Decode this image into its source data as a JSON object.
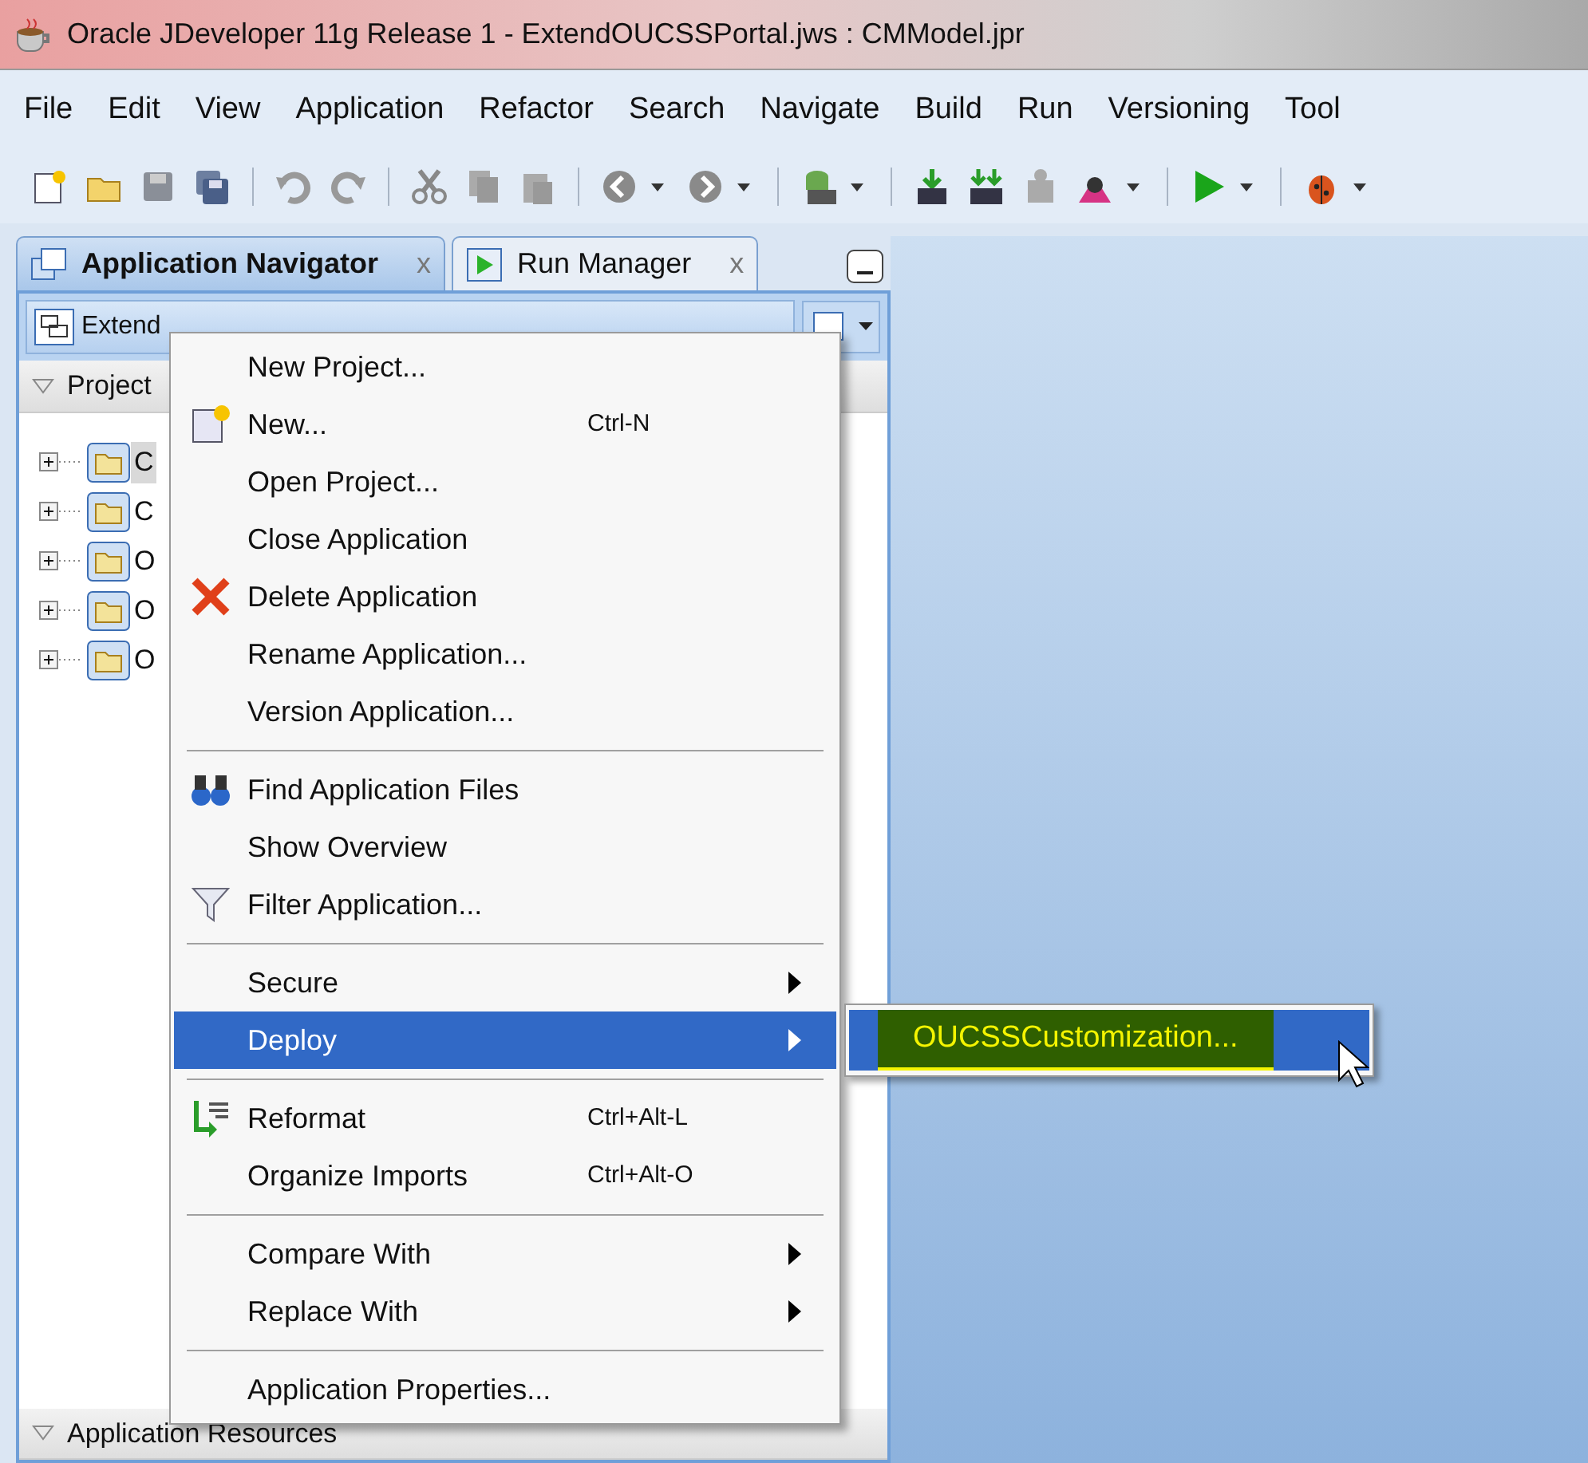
{
  "window": {
    "title": "Oracle JDeveloper 11g Release 1 - ExtendOUCSSPortal.jws : CMModel.jpr"
  },
  "menu_bar": [
    "File",
    "Edit",
    "View",
    "Application",
    "Refactor",
    "Search",
    "Navigate",
    "Build",
    "Run",
    "Versioning",
    "Tool"
  ],
  "navigator": {
    "tabs": [
      {
        "label": "Application Navigator",
        "close": "x",
        "selected": true
      },
      {
        "label": "Run Manager",
        "close": "x",
        "selected": false
      }
    ],
    "application": "Extend",
    "projects_section": {
      "label": "Project",
      "expanded": true
    },
    "tree": [
      {
        "label": "C",
        "selected": true
      },
      {
        "label": "C",
        "selected": false
      },
      {
        "label": "O",
        "selected": false
      },
      {
        "label": "O",
        "selected": false
      },
      {
        "label": "O",
        "selected": false
      }
    ],
    "resources_section": {
      "label": "Application Resources",
      "expanded": true
    }
  },
  "context_menu": {
    "items": [
      {
        "kind": "item",
        "label": "New Project...",
        "selected": false
      },
      {
        "kind": "item",
        "label": "New...",
        "shortcut": "Ctrl-N",
        "selected": false
      },
      {
        "kind": "item",
        "label": "Open Project...",
        "selected": false
      },
      {
        "kind": "item",
        "label": "Close Application",
        "selected": false
      },
      {
        "kind": "item",
        "label": "Delete Application",
        "selected": false
      },
      {
        "kind": "item",
        "label": "Rename Application...",
        "selected": false
      },
      {
        "kind": "item",
        "label": "Version Application...",
        "selected": false
      },
      {
        "kind": "separator"
      },
      {
        "kind": "item",
        "label": "Find Application Files",
        "selected": false
      },
      {
        "kind": "item",
        "label": "Show Overview",
        "selected": false
      },
      {
        "kind": "item",
        "label": "Filter Application...",
        "selected": false
      },
      {
        "kind": "separator"
      },
      {
        "kind": "submenu",
        "label": "Secure",
        "selected": false
      },
      {
        "kind": "submenu",
        "label": "Deploy",
        "selected": true
      },
      {
        "kind": "separator"
      },
      {
        "kind": "item",
        "label": "Reformat",
        "shortcut": "Ctrl+Alt-L",
        "selected": false
      },
      {
        "kind": "item",
        "label": "Organize Imports",
        "shortcut": "Ctrl+Alt-O",
        "selected": false
      },
      {
        "kind": "separator"
      },
      {
        "kind": "submenu",
        "label": "Compare With",
        "selected": false
      },
      {
        "kind": "submenu",
        "label": "Replace With",
        "selected": false
      },
      {
        "kind": "separator"
      },
      {
        "kind": "item",
        "label": "Application Properties...",
        "selected": false
      }
    ]
  },
  "submenu": {
    "items": [
      {
        "label": "OUCSSCustomization...",
        "selected": true
      }
    ]
  }
}
